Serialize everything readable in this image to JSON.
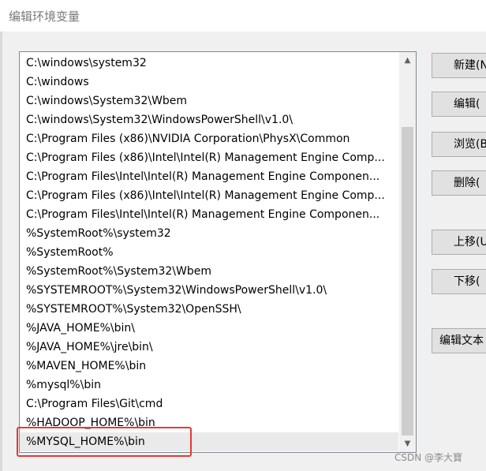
{
  "window": {
    "title": "编辑环境变量"
  },
  "path_list": [
    "C:\\windows\\system32",
    "C:\\windows",
    "C:\\windows\\System32\\Wbem",
    "C:\\windows\\System32\\WindowsPowerShell\\v1.0\\",
    "C:\\Program Files (x86)\\NVIDIA Corporation\\PhysX\\Common",
    "C:\\Program Files (x86)\\Intel\\Intel(R) Management Engine Comp...",
    "C:\\Program Files\\Intel\\Intel(R) Management Engine Componen...",
    "C:\\Program Files (x86)\\Intel\\Intel(R) Management Engine Comp...",
    "C:\\Program Files\\Intel\\Intel(R) Management Engine Componen...",
    "%SystemRoot%\\system32",
    "%SystemRoot%",
    "%SystemRoot%\\System32\\Wbem",
    "%SYSTEMROOT%\\System32\\WindowsPowerShell\\v1.0\\",
    "%SYSTEMROOT%\\System32\\OpenSSH\\",
    "%JAVA_HOME%\\bin\\",
    "%JAVA_HOME%\\jre\\bin\\",
    "%MAVEN_HOME%\\bin",
    "%mysql%\\bin",
    "C:\\Program Files\\Git\\cmd",
    "%HADOOP_HOME%\\bin",
    "%MYSQL_HOME%\\bin"
  ],
  "selected_index": 20,
  "buttons": {
    "new": "新建(N",
    "edit": "编辑(",
    "browse": "浏览(B",
    "delete": "删除(",
    "move_up": "上移(U",
    "move_down": "下移(",
    "edit_text": "编辑文本"
  },
  "scrollbar": {
    "up_arrow": "▲",
    "down_arrow": "▼"
  },
  "watermark": "CSDN @李大寶",
  "colors": {
    "highlight_border": "#e53935",
    "selected_row": "#eaeaea"
  }
}
